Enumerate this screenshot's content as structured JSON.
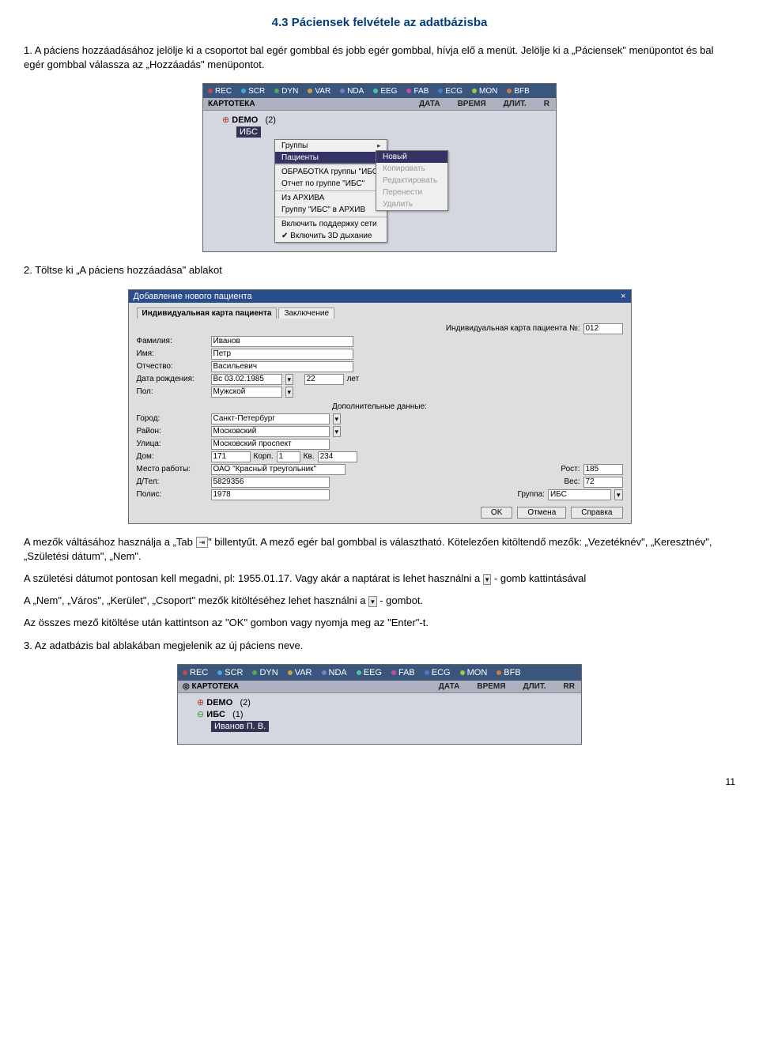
{
  "title": "4.3 Páciensek felvétele az adatbázisba",
  "p1": "1. A páciens hozzáadásához jelölje ki a csoportot bal egér gombbal és jobb egér gombbal, hívja elő a menüt. Jelölje ki a „Páciensek\" menüpontot és bal egér gombbal válassza az „Hozzáadás\" menüpontot.",
  "p2": "2. Töltse ki „A páciens hozzáadása\" ablakot",
  "p3a": "A mezők váltásához használja a „Tab ",
  "p3b": "\" billentyűt. A mező egér bal gombbal is választható. Kötelezően kitöltendő mezők: „Vezetéknév\", „Keresztnév\", „Születési dátum\", „Nem\".",
  "p4a": "A születési dátumot pontosan kell megadni,  pl: 1955.01.17. Vagy akár a naptárat is lehet használni a ",
  "p4b": " - gomb kattintásával",
  "p5a": "A „Nem\", „Város\", „Kerület\", „Csoport\" mezők kitöltéséhez lehet használni a ",
  "p5b": " - gombot.",
  "p6": "Az összes mező kitöltése után kattintson az \"OK\" gombon vagy nyomja meg az \"Enter\"-t.",
  "p7": "3. Az adatbázis bal ablakában megjelenik az új páciens neve.",
  "pagenum": "11",
  "tab_key": "⇥",
  "dropdown_icon": "▾",
  "toolbar": {
    "items": [
      {
        "label": "REC",
        "color": "#c94a4a"
      },
      {
        "label": "SCR",
        "color": "#3fa8e0"
      },
      {
        "label": "DYN",
        "color": "#4fa84f"
      },
      {
        "label": "VAR",
        "color": "#c9a04a"
      },
      {
        "label": "NDA",
        "color": "#7a7ac9"
      },
      {
        "label": "EEG",
        "color": "#4ac9a0"
      },
      {
        "label": "FAB",
        "color": "#c94aa0"
      },
      {
        "label": "ECG",
        "color": "#4a77c9"
      },
      {
        "label": "MON",
        "color": "#a0c94a"
      },
      {
        "label": "BFB",
        "color": "#c97a4a"
      }
    ]
  },
  "ss1": {
    "panel_title": "КАРТОТЕКА",
    "headers": [
      "ДАТА",
      "ВРЕМЯ",
      "ДЛИТ.",
      "R"
    ],
    "tree_demo": "DEMO",
    "tree_demo_count": "(2)",
    "tree_ibs": "ИБС",
    "menu": {
      "items": [
        {
          "label": "Группы",
          "arrow": true
        },
        {
          "label": "Пациенты",
          "arrow": true,
          "sel": true
        },
        {
          "label": "ОБРАБОТКА группы \"ИБС\""
        },
        {
          "label": "Отчет по группе \"ИБС\""
        },
        {
          "label": "Из АРХИВА"
        },
        {
          "label": "Группу \"ИБС\" в АРХИВ"
        },
        {
          "label": "Включить поддержку сети"
        },
        {
          "label": "✔ Включить 3D дыхание"
        }
      ]
    },
    "submenu": {
      "items": [
        {
          "label": "Новый",
          "sel": true
        },
        {
          "label": "Копировать",
          "dis": true
        },
        {
          "label": "Редактировать",
          "dis": true
        },
        {
          "label": "Перенести",
          "dis": true
        },
        {
          "label": "Удалить",
          "dis": true
        }
      ]
    }
  },
  "ss2": {
    "title": "Добавление нового пациента",
    "close": "×",
    "tabs": [
      "Индивидуальная карта пациента",
      "Заключение"
    ],
    "card_no_lbl": "Индивидуальная карта пациента №:",
    "card_no": "012",
    "surname_lbl": "Фамилия:",
    "surname": "Иванов",
    "name_lbl": "Имя:",
    "name": "Петр",
    "patr_lbl": "Отчество:",
    "patr": "Васильевич",
    "dob_lbl": "Дата рождения:",
    "dob": "Вс 03.02.1985",
    "age": "22",
    "age_lbl": "лет",
    "sex_lbl": "Пол:",
    "sex": "Мужской",
    "extra_lbl": "Дополнительные данные:",
    "city_lbl": "Город:",
    "city": "Санкт-Петербург",
    "district_lbl": "Район:",
    "district": "Московский",
    "street_lbl": "Улица:",
    "street": "Московский проспект",
    "house_lbl": "Дом:",
    "house": "171",
    "korp_lbl": "Корп.",
    "korp": "1",
    "kv_lbl": "Кв.",
    "kv": "234",
    "work_lbl": "Место работы:",
    "work": "ОАО \"Красный треугольник\"",
    "tel_lbl": "Д/Тел:",
    "tel": "5829356",
    "polis_lbl": "Полис:",
    "polis": "1978",
    "height_lbl": "Рост:",
    "height": "185",
    "weight_lbl": "Вес:",
    "weight": "72",
    "group_lbl": "Группа:",
    "group": "ИБС",
    "ok": "OK",
    "cancel": "Отмена",
    "help": "Справка"
  },
  "ss3": {
    "panel_title": "КАРТОТЕКА",
    "headers": [
      "ДАТА",
      "ВРЕМЯ",
      "ДЛИТ.",
      "RR"
    ],
    "tree": [
      {
        "label": "DEMO",
        "count": "(2)"
      },
      {
        "label": "ИБС",
        "count": "(1)"
      }
    ],
    "patient": "Иванов П. В."
  }
}
